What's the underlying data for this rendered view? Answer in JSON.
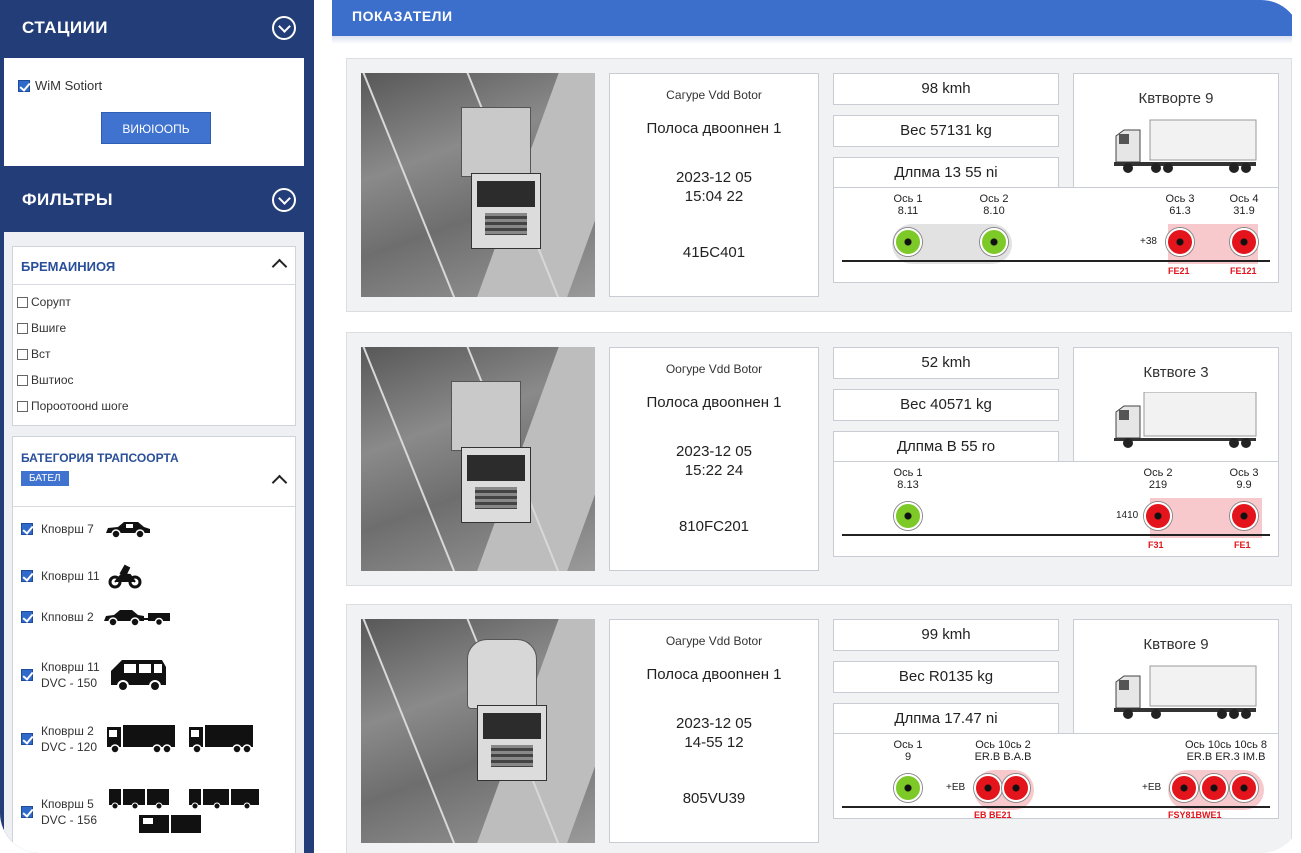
{
  "sidebar": {
    "stations_title": "СТАЦИИИ",
    "station_checkbox": "WiM Sotiort",
    "station_button": "ВИЮІООПЬ",
    "filters_title": "ФИЛЬТРЫ",
    "time_title": "БРЕМАИНИОЯ",
    "time_options": [
      "Сорупт",
      "Вшиге",
      "Вст",
      "Вштиос",
      "Пороотоонd шоге"
    ],
    "category_title": "БАТЕГОРИЯ ТРАПСООРТА",
    "category_badge": "БАТЕЛ",
    "categories": [
      {
        "line1": "Кповрш 7",
        "line2": "",
        "icon": "car-icon"
      },
      {
        "line1": "Кповрш 11",
        "line2": "",
        "icon": "motorcycle-icon"
      },
      {
        "line1": "Кпповш 2",
        "line2": "",
        "icon": "car-trailer-icon"
      },
      {
        "line1": "Кповрш 11",
        "line2": "DVC - 150",
        "icon": "van-icon"
      },
      {
        "line1": "Кповрш 2",
        "line2": "DVC - 120",
        "icon": "truck-icon"
      },
      {
        "line1": "Кповрш 5",
        "line2": "DVC - 156",
        "icon": "road-train-icon"
      }
    ]
  },
  "main": {
    "title": "ПОКАЗАТЕЛИ",
    "records": [
      {
        "camera": "Сагуре Vdd Вotor",
        "lane": "Полоса двоonнен 1",
        "date": "2023-12 05",
        "time": "15:04 22",
        "plate": "41БС401",
        "speed": "98 kmh",
        "weight": "Вес 57131 kg",
        "length": "Длпма 13 55 ni",
        "category": "Квтворте 9",
        "axles": [
          {
            "label": "Ось 1",
            "value": "8.11",
            "status": "ok"
          },
          {
            "label": "Ось 2",
            "value": "8.10",
            "status": "ok"
          },
          {
            "label": "Ось 3",
            "value": "61.3",
            "status": "over"
          },
          {
            "label": "Ось 4",
            "value": "31.9",
            "status": "over"
          }
        ],
        "left_note": "+38",
        "red_notes": [
          "FE21",
          "FE121"
        ]
      },
      {
        "camera": "Оогуре Vdd Вotor",
        "lane": "Полоса двоonнен 1",
        "date": "2023-12 05",
        "time": "15:22 24",
        "plate": "810FC201",
        "speed": "52 kmh",
        "weight": "Вес 40571 kg",
        "length": "Длпма В 55 ro",
        "category": "Квтвоrе 3",
        "axles": [
          {
            "label": "Ось 1",
            "value": "8.13",
            "status": "ok"
          },
          {
            "label": "Ось 2",
            "value": "219",
            "status": "over"
          },
          {
            "label": "Ось 3",
            "value": "9.9",
            "status": "over"
          }
        ],
        "left_note": "1410",
        "red_notes": [
          "F31",
          "FE1"
        ]
      },
      {
        "camera": "Оагуре Vdd Вotor",
        "lane": "Полоса двоonнен 1",
        "date": "2023-12 05",
        "time": "14-55 12",
        "plate": "805VU39",
        "speed": "99 kmh",
        "weight": "Вес R0135 kg",
        "length": "Длпма 17.47 ni",
        "category": "Квтвоrе 9",
        "axle1_label": "Ось 1",
        "axle1_value": "9",
        "group2_label": "Ось 10сь 2",
        "group2_values": "ER.B В.А.В",
        "group3_label": "Ось 10сь 10сь 8",
        "group3_values": "ER.B ER.3 IM.B",
        "mid_note": "+EB",
        "right_note": "+EB",
        "red_notes": [
          "ЕВ ВЕ21",
          "FSY81BWE1"
        ]
      }
    ]
  },
  "colors": {
    "sidebar": "#233d78",
    "accent": "#3c6ecb",
    "ok": "#7cc928",
    "over": "#e3141c"
  }
}
